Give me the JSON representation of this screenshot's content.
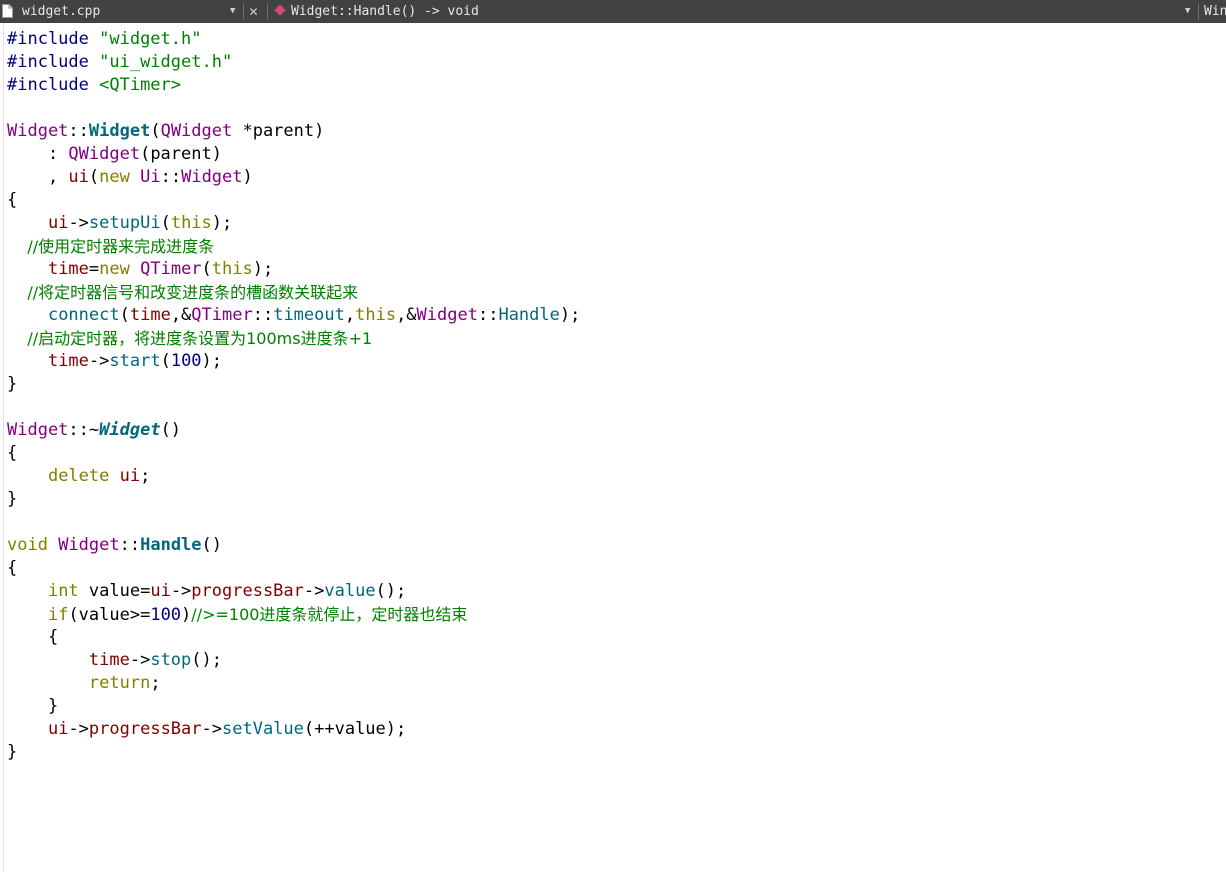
{
  "toolbar": {
    "file_name": "widget.cpp",
    "symbol_name": "Widget::Handle() -> void",
    "right_name": "Win"
  },
  "colors": {
    "preprocessor": "#000080",
    "string": "#008000",
    "type": "#800080",
    "member": "#800000",
    "keyword": "#808000",
    "function": "#00677C",
    "comment": "#008000",
    "number": "#000080",
    "plain": "#000000"
  },
  "code": [
    [
      {
        "t": "#include ",
        "c": "preprocessor"
      },
      {
        "t": "\"widget.h\"",
        "c": "string"
      }
    ],
    [
      {
        "t": "#include ",
        "c": "preprocessor"
      },
      {
        "t": "\"ui_widget.h\"",
        "c": "string"
      }
    ],
    [
      {
        "t": "#include ",
        "c": "preprocessor"
      },
      {
        "t": "<QTimer>",
        "c": "string"
      }
    ],
    [],
    [
      {
        "t": "Widget",
        "c": "type"
      },
      {
        "t": "::",
        "c": "plain"
      },
      {
        "t": "Widget",
        "c": "function",
        "s": "b"
      },
      {
        "t": "(",
        "c": "plain"
      },
      {
        "t": "QWidget",
        "c": "type"
      },
      {
        "t": " *parent)",
        "c": "plain"
      }
    ],
    [
      {
        "t": "    : ",
        "c": "plain"
      },
      {
        "t": "QWidget",
        "c": "type"
      },
      {
        "t": "(parent)",
        "c": "plain"
      }
    ],
    [
      {
        "t": "    , ",
        "c": "plain"
      },
      {
        "t": "ui",
        "c": "member"
      },
      {
        "t": "(",
        "c": "plain"
      },
      {
        "t": "new",
        "c": "keyword"
      },
      {
        "t": " ",
        "c": "plain"
      },
      {
        "t": "Ui",
        "c": "type"
      },
      {
        "t": "::",
        "c": "plain"
      },
      {
        "t": "Widget",
        "c": "type"
      },
      {
        "t": ")",
        "c": "plain"
      }
    ],
    [
      {
        "t": "{",
        "c": "plain"
      }
    ],
    [
      {
        "t": "    ",
        "c": "plain"
      },
      {
        "t": "ui",
        "c": "member"
      },
      {
        "t": "->",
        "c": "plain"
      },
      {
        "t": "setupUi",
        "c": "function"
      },
      {
        "t": "(",
        "c": "plain"
      },
      {
        "t": "this",
        "c": "keyword"
      },
      {
        "t": ");",
        "c": "plain"
      }
    ],
    [
      {
        "t": "    //使用定时器来完成进度条",
        "c": "comment",
        "s": "cm"
      }
    ],
    [
      {
        "t": "    ",
        "c": "plain"
      },
      {
        "t": "time",
        "c": "member"
      },
      {
        "t": "=",
        "c": "plain"
      },
      {
        "t": "new",
        "c": "keyword"
      },
      {
        "t": " ",
        "c": "plain"
      },
      {
        "t": "QTimer",
        "c": "type"
      },
      {
        "t": "(",
        "c": "plain"
      },
      {
        "t": "this",
        "c": "keyword"
      },
      {
        "t": ");",
        "c": "plain"
      }
    ],
    [
      {
        "t": "    //将定时器信号和改变进度条的槽函数关联起来",
        "c": "comment",
        "s": "cm"
      }
    ],
    [
      {
        "t": "    ",
        "c": "plain"
      },
      {
        "t": "connect",
        "c": "function"
      },
      {
        "t": "(",
        "c": "plain"
      },
      {
        "t": "time",
        "c": "member"
      },
      {
        "t": ",&",
        "c": "plain"
      },
      {
        "t": "QTimer",
        "c": "type"
      },
      {
        "t": "::",
        "c": "plain"
      },
      {
        "t": "timeout",
        "c": "function"
      },
      {
        "t": ",",
        "c": "plain"
      },
      {
        "t": "this",
        "c": "keyword"
      },
      {
        "t": ",&",
        "c": "plain"
      },
      {
        "t": "Widget",
        "c": "type"
      },
      {
        "t": "::",
        "c": "plain"
      },
      {
        "t": "Handle",
        "c": "function"
      },
      {
        "t": ");",
        "c": "plain"
      }
    ],
    [
      {
        "t": "    //启动定时器，将进度条设置为100ms进度条+1",
        "c": "comment",
        "s": "cm"
      }
    ],
    [
      {
        "t": "    ",
        "c": "plain"
      },
      {
        "t": "time",
        "c": "member"
      },
      {
        "t": "->",
        "c": "plain"
      },
      {
        "t": "start",
        "c": "function"
      },
      {
        "t": "(",
        "c": "plain"
      },
      {
        "t": "100",
        "c": "number"
      },
      {
        "t": ");",
        "c": "plain"
      }
    ],
    [
      {
        "t": "}",
        "c": "plain"
      }
    ],
    [],
    [
      {
        "t": "Widget",
        "c": "type"
      },
      {
        "t": "::~",
        "c": "plain"
      },
      {
        "t": "Widget",
        "c": "function",
        "s": "b i"
      },
      {
        "t": "()",
        "c": "plain"
      }
    ],
    [
      {
        "t": "{",
        "c": "plain"
      }
    ],
    [
      {
        "t": "    ",
        "c": "plain"
      },
      {
        "t": "delete",
        "c": "keyword"
      },
      {
        "t": " ",
        "c": "plain"
      },
      {
        "t": "ui",
        "c": "member"
      },
      {
        "t": ";",
        "c": "plain"
      }
    ],
    [
      {
        "t": "}",
        "c": "plain"
      }
    ],
    [],
    [
      {
        "t": "void",
        "c": "keyword"
      },
      {
        "t": " ",
        "c": "plain"
      },
      {
        "t": "Widget",
        "c": "type"
      },
      {
        "t": "::",
        "c": "plain"
      },
      {
        "t": "Handle",
        "c": "function",
        "s": "b"
      },
      {
        "t": "()",
        "c": "plain"
      }
    ],
    [
      {
        "t": "{",
        "c": "plain"
      }
    ],
    [
      {
        "t": "    ",
        "c": "plain"
      },
      {
        "t": "int",
        "c": "keyword"
      },
      {
        "t": " value=",
        "c": "plain"
      },
      {
        "t": "ui",
        "c": "member"
      },
      {
        "t": "->",
        "c": "plain"
      },
      {
        "t": "progressBar",
        "c": "member"
      },
      {
        "t": "->",
        "c": "plain"
      },
      {
        "t": "value",
        "c": "function"
      },
      {
        "t": "();",
        "c": "plain"
      }
    ],
    [
      {
        "t": "    ",
        "c": "plain"
      },
      {
        "t": "if",
        "c": "keyword"
      },
      {
        "t": "(value>=",
        "c": "plain"
      },
      {
        "t": "100",
        "c": "number"
      },
      {
        "t": ")",
        "c": "plain"
      },
      {
        "t": "//>=100进度条就停止，定时器也结束",
        "c": "comment",
        "s": "cm"
      }
    ],
    [
      {
        "t": "    {",
        "c": "plain"
      }
    ],
    [
      {
        "t": "        ",
        "c": "plain"
      },
      {
        "t": "time",
        "c": "member"
      },
      {
        "t": "->",
        "c": "plain"
      },
      {
        "t": "stop",
        "c": "function"
      },
      {
        "t": "();",
        "c": "plain"
      }
    ],
    [
      {
        "t": "        ",
        "c": "plain"
      },
      {
        "t": "return",
        "c": "keyword"
      },
      {
        "t": ";",
        "c": "plain"
      }
    ],
    [
      {
        "t": "    }",
        "c": "plain"
      }
    ],
    [
      {
        "t": "    ",
        "c": "plain"
      },
      {
        "t": "ui",
        "c": "member"
      },
      {
        "t": "->",
        "c": "plain"
      },
      {
        "t": "progressBar",
        "c": "member"
      },
      {
        "t": "->",
        "c": "plain"
      },
      {
        "t": "setValue",
        "c": "function"
      },
      {
        "t": "(++value);",
        "c": "plain"
      }
    ],
    [
      {
        "t": "}",
        "c": "plain"
      }
    ]
  ]
}
